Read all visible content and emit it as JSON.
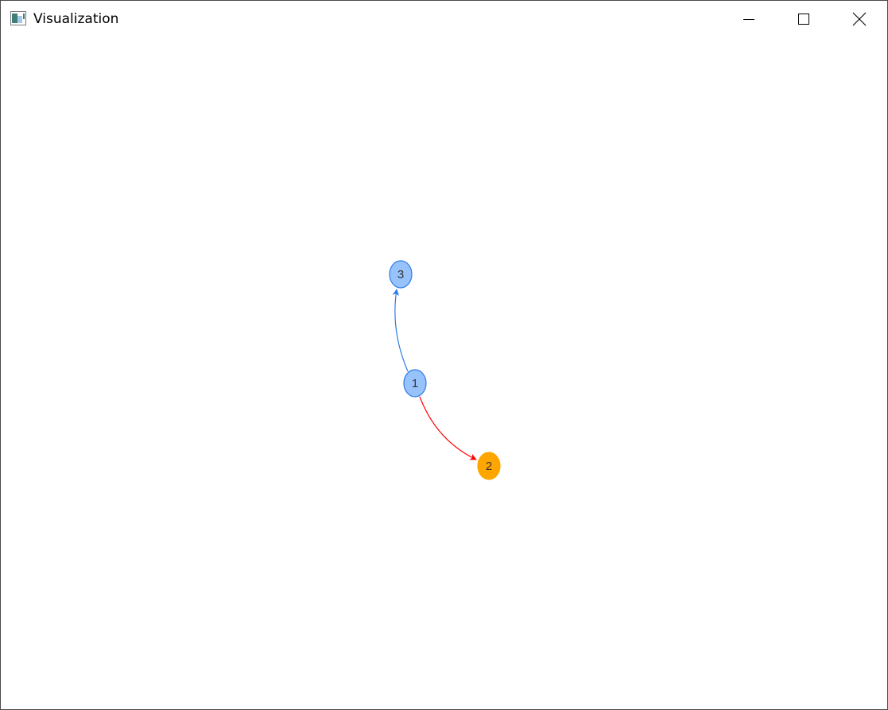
{
  "window": {
    "title": "Visualization",
    "controls": {
      "minimize_icon": "minimize-icon",
      "maximize_icon": "maximize-icon",
      "close_icon": "close-icon"
    }
  },
  "graph": {
    "nodes": [
      {
        "id": "1",
        "label": "1",
        "fill": "#97c2fc",
        "stroke": "#2b7ce9"
      },
      {
        "id": "2",
        "label": "2",
        "fill": "#ffa500",
        "stroke": "#ffa500"
      },
      {
        "id": "3",
        "label": "3",
        "fill": "#97c2fc",
        "stroke": "#2b7ce9"
      }
    ],
    "edges": [
      {
        "from": "1",
        "to": "3",
        "color": "#2b7ce9",
        "directed": true
      },
      {
        "from": "1",
        "to": "2",
        "color": "#ff0000",
        "directed": true
      }
    ]
  }
}
